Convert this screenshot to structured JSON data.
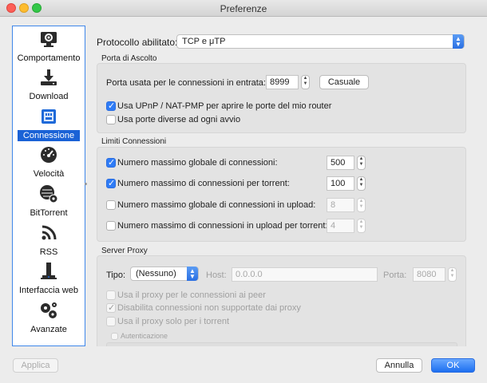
{
  "window": {
    "title": "Preferenze"
  },
  "sidebar": {
    "items": [
      {
        "label": "Comportamento",
        "icon": "monitor-gear-icon"
      },
      {
        "label": "Download",
        "icon": "download-icon"
      },
      {
        "label": "Connessione",
        "icon": "network-icon",
        "selected": true
      },
      {
        "label": "Velocità",
        "icon": "speedometer-icon"
      },
      {
        "label": "BitTorrent",
        "icon": "globe-gear-icon"
      },
      {
        "label": "RSS",
        "icon": "rss-icon"
      },
      {
        "label": "Interfaccia web",
        "icon": "web-ui-icon"
      },
      {
        "label": "Avanzate",
        "icon": "gears-icon"
      }
    ]
  },
  "protocol": {
    "label": "Protocollo abilitato:",
    "value": "TCP e μTP"
  },
  "listening": {
    "title": "Porta di Ascolto",
    "port_label": "Porta usata per le connessioni in entrata:",
    "port_value": "8999",
    "random_button": "Casuale",
    "upnp_label": "Usa UPnP / NAT-PMP per aprire le porte del mio router",
    "upnp_checked": true,
    "random_each_start_label": "Usa porte diverse ad ogni avvio",
    "random_each_start_checked": false
  },
  "limits": {
    "title": "Limiti Connessioni",
    "rows": [
      {
        "label": "Numero massimo globale di connessioni:",
        "value": "500",
        "checked": true
      },
      {
        "label": "Numero massimo di connessioni per torrent:",
        "value": "100",
        "checked": true
      },
      {
        "label": "Numero massimo globale di connessioni in upload:",
        "value": "8",
        "checked": false
      },
      {
        "label": "Numero massimo di connessioni in upload per torrent:",
        "value": "4",
        "checked": false
      }
    ]
  },
  "proxy": {
    "title": "Server Proxy",
    "type_label": "Tipo:",
    "type_value": "(Nessuno)",
    "host_label": "Host:",
    "host_placeholder": "0.0.0.0",
    "port_label": "Porta:",
    "port_value": "8080",
    "peer_label": "Usa il proxy per le connessioni ai peer",
    "disable_label": "Disabilita connessioni non supportate dai proxy",
    "torrent_only_label": "Usa il proxy solo per i torrent",
    "auth_label": "Autenticazione"
  },
  "footer": {
    "apply": "Applica",
    "cancel": "Annulla",
    "ok": "OK"
  },
  "colors": {
    "accent": "#2f7cf6",
    "selection": "#1a62d6"
  }
}
